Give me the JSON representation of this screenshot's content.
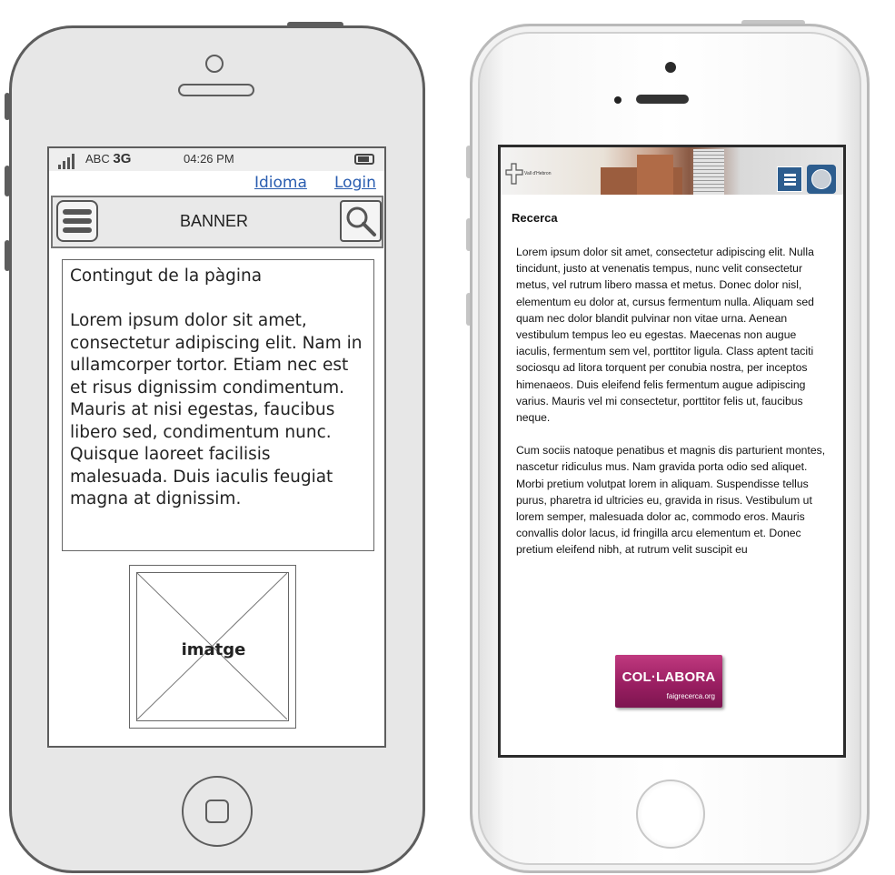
{
  "wireframe": {
    "status": {
      "carrier": "ABC",
      "network": "3G",
      "time": "04:26 PM"
    },
    "links": {
      "idioma": "Idioma",
      "login": "Login"
    },
    "banner": "BANNER",
    "content": {
      "heading": "Contingut de la pàgina",
      "body": "Lorem ipsum dolor sit amet, consectetur adipiscing elit. Nam in ullamcorper tortor. Etiam nec est et risus dignissim condimentum. Mauris at nisi egestas, faucibus libero sed, condimentum nunc. Quisque laoreet facilisis malesuada. Duis iaculis feugiat magna at dignissim."
    },
    "image_label": "imatge"
  },
  "mockup": {
    "header": {
      "logo_text": "Vall d'Hebron"
    },
    "title": "Recerca",
    "paragraphs": [
      "Lorem ipsum dolor sit amet, consectetur adipiscing elit. Nulla tincidunt, justo at venenatis tempus, nunc velit consectetur metus, vel rutrum libero massa et metus. Donec dolor nisl, elementum eu dolor at, cursus fermentum nulla. Aliquam sed quam nec dolor blandit pulvinar non vitae urna. Aenean vestibulum tempus leo eu egestas. Maecenas non augue iaculis, fermentum sem vel, porttitor ligula. Class aptent taciti sociosqu ad litora torquent per conubia nostra, per inceptos himenaeos. Duis eleifend felis fermentum augue adipiscing varius. Mauris vel mi consectetur, porttitor felis ut, faucibus neque.",
      "Cum sociis natoque penatibus et magnis dis parturient montes, nascetur ridiculus mus. Nam gravida porta odio sed aliquet. Morbi pretium volutpat lorem in aliquam. Suspendisse tellus purus, pharetra id ultricies eu, gravida in risus. Vestibulum ut lorem semper, malesuada dolor ac, commodo eros. Mauris convallis dolor lacus, id fringilla arcu elementum et. Donec pretium eleifend nibh, at rutrum velit suscipit eu"
    ],
    "button": {
      "label": "COL·LABORA",
      "sub": "faigrecerca.org"
    }
  },
  "colors": {
    "link": "#2a5db0",
    "header_blue": "#2d5d8e",
    "button_magenta": "#9a1f62"
  }
}
